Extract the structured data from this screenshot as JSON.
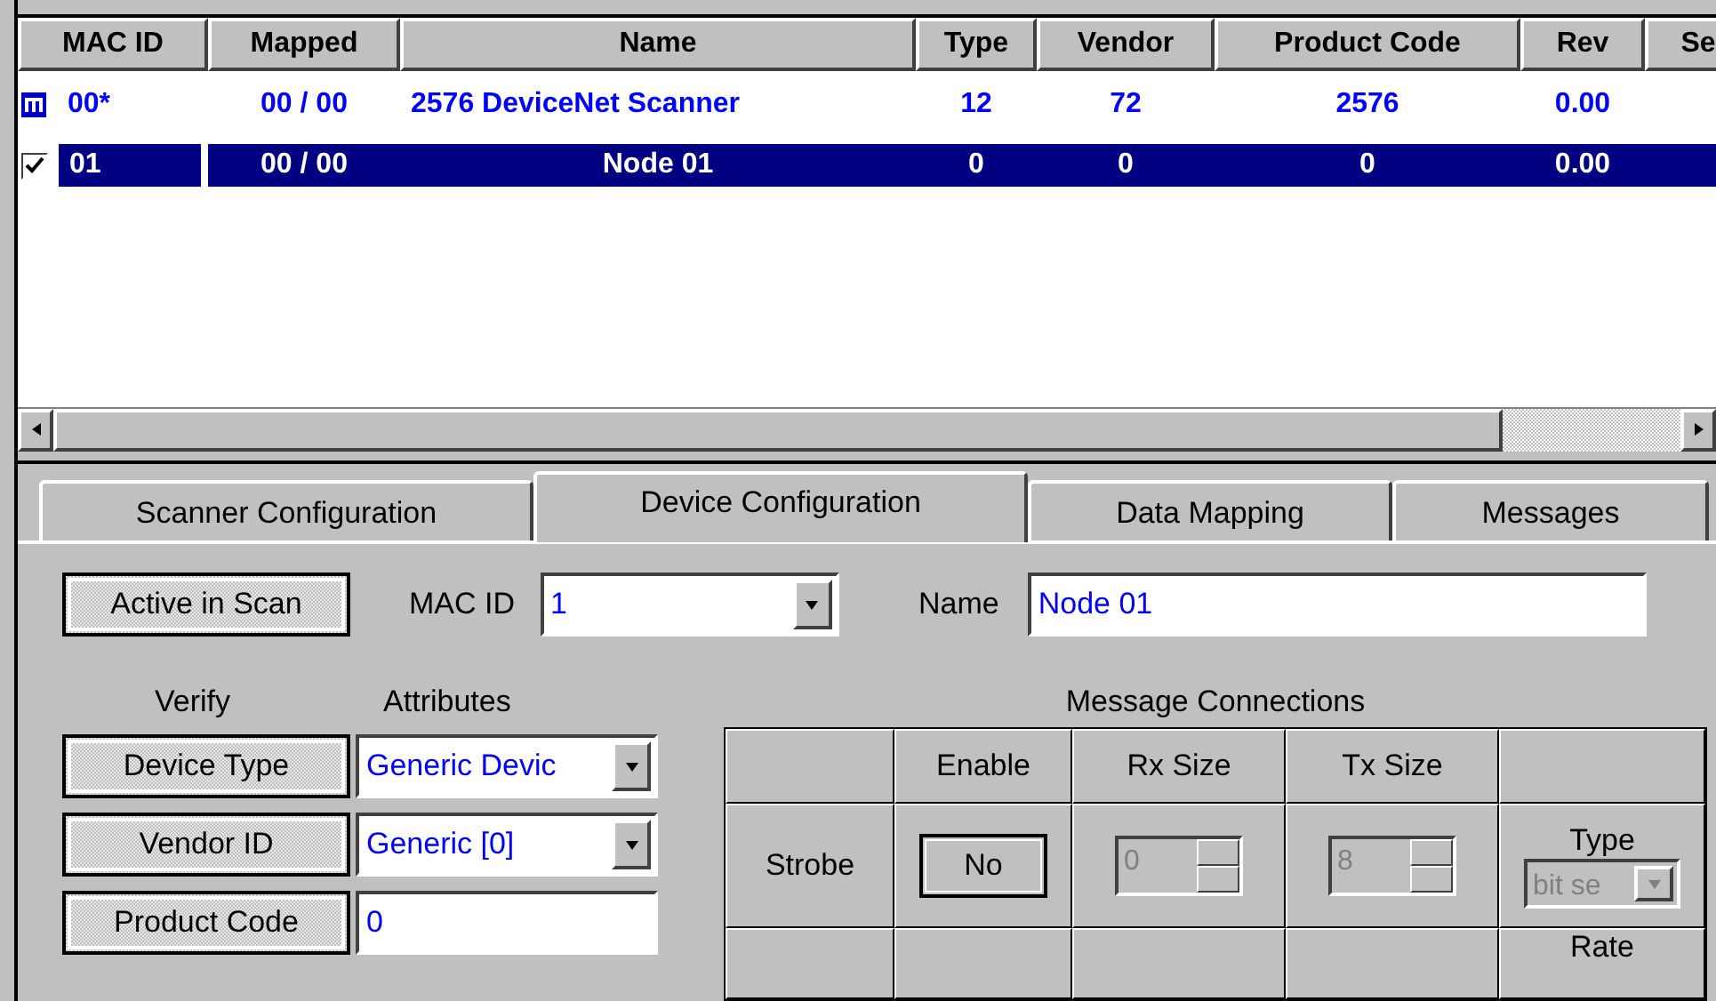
{
  "device_list": {
    "columns": [
      "MAC ID",
      "Mapped",
      "Name",
      "Type",
      "Vendor",
      "Product Code",
      "Rev",
      "Se"
    ],
    "rows": [
      {
        "kind": "scanner",
        "selected": false,
        "cells": [
          "00*",
          "00 / 00",
          "2576 DeviceNet Scanner",
          "12",
          "72",
          "2576",
          "0.00"
        ]
      },
      {
        "kind": "node",
        "selected": true,
        "checked": true,
        "cells": [
          "01",
          "00 / 00",
          "Node 01",
          "0",
          "0",
          "0",
          "0.00"
        ]
      }
    ]
  },
  "tabs": [
    {
      "label": "Scanner Configuration",
      "selected": false
    },
    {
      "label": "Device Configuration",
      "selected": true
    },
    {
      "label": "Data Mapping",
      "selected": false
    },
    {
      "label": "Messages",
      "selected": false
    }
  ],
  "active_in_scan": {
    "label": "Active in Scan",
    "pressed": true
  },
  "mac_id": {
    "label": "MAC ID",
    "value": "1"
  },
  "name": {
    "label": "Name",
    "value": "Node 01"
  },
  "verify": {
    "heading": "Verify",
    "attributes_heading": "Attributes",
    "items": [
      {
        "label": "Device Type",
        "pressed": true,
        "kind": "combo",
        "value": "Generic Devic"
      },
      {
        "label": "Vendor ID",
        "pressed": true,
        "kind": "combo",
        "value": "Generic  [0]"
      },
      {
        "label": "Product Code",
        "pressed": true,
        "kind": "text",
        "value": "0"
      }
    ]
  },
  "message_connections": {
    "title": "Message Connections",
    "columns": [
      "Enable",
      "Rx Size",
      "Tx Size"
    ],
    "rows": [
      {
        "label": "Strobe",
        "enable": "No",
        "rx_size": "0",
        "tx_size": "8",
        "disabled": true,
        "option_label": "Type",
        "option_value": "bit se"
      }
    ],
    "next_row_label": "Rate"
  }
}
